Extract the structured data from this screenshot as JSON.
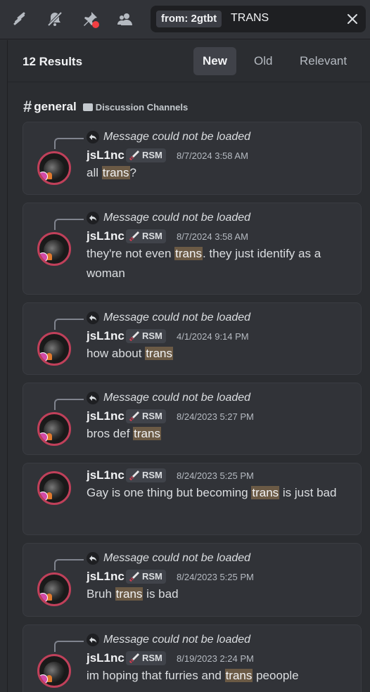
{
  "toolbar": {
    "icons": [
      "threads-icon",
      "notifications-muted-icon",
      "pinned-messages-icon",
      "member-list-icon"
    ]
  },
  "search": {
    "filter_chip": "from: 2gtbt",
    "query": "TRANS"
  },
  "results": {
    "count_label": "12 Results",
    "sort": {
      "new": "New",
      "old": "Old",
      "relevant": "Relevant",
      "active": "New"
    }
  },
  "channel": {
    "name": "general",
    "category": "Discussion Channels"
  },
  "messages": [
    {
      "reply": "Message could not be loaded",
      "user": "jsL1nc",
      "tag": "RSM",
      "time": "8/7/2024 3:58 AM",
      "pre": "all ",
      "hl": "trans",
      "post": "?"
    },
    {
      "reply": "Message could not be loaded",
      "user": "jsL1nc",
      "tag": "RSM",
      "time": "8/7/2024 3:58 AM",
      "pre": "they're not even ",
      "hl": "trans",
      "post": ". they just identify as a woman"
    },
    {
      "reply": "Message could not be loaded",
      "user": "jsL1nc",
      "tag": "RSM",
      "time": "4/1/2024 9:14 PM",
      "pre": "how about ",
      "hl": "trans",
      "post": ""
    },
    {
      "reply": "Message could not be loaded",
      "user": "jsL1nc",
      "tag": "RSM",
      "time": "8/24/2023 5:27 PM",
      "pre": "bros def ",
      "hl": "trans",
      "post": ""
    },
    {
      "reply": "",
      "user": "jsL1nc",
      "tag": "RSM",
      "time": "8/24/2023 5:25 PM",
      "pre": "Gay is one thing but becoming ",
      "hl": "trans",
      "post": " is just bad"
    },
    {
      "reply": "Message could not be loaded",
      "user": "jsL1nc",
      "tag": "RSM",
      "time": "8/24/2023 5:25 PM",
      "pre": "Bruh ",
      "hl": "trans",
      "post": " is bad"
    },
    {
      "reply": "Message could not be loaded",
      "user": "jsL1nc",
      "tag": "RSM",
      "time": "8/19/2023 2:24 PM",
      "pre": "im hoping that furries and ",
      "hl": "trans",
      "post": " peoople"
    }
  ],
  "colors": {
    "highlight": "#6b5a45",
    "avatar_ring": "#c0405a",
    "background": "#2b2d31"
  }
}
